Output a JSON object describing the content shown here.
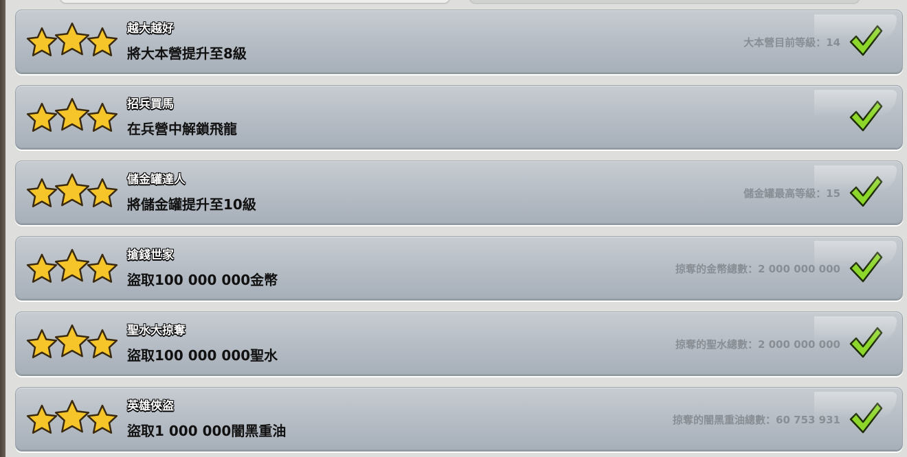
{
  "colors": {
    "card_top": "#c7ccd1",
    "card_bottom": "#a7afb9",
    "star_fill": "#f5c52a",
    "check_fill": "#8dd62a",
    "status_text": "#888e94"
  },
  "icons": {
    "star": "star-icon",
    "check": "checkmark-icon"
  },
  "achievements": [
    {
      "title": "越大越好",
      "description": "將大本營提升至8級",
      "status": "大本營目前等級：14",
      "stars": 3,
      "completed": true
    },
    {
      "title": "招兵買馬",
      "description": "在兵營中解鎖飛龍",
      "status": "",
      "stars": 3,
      "completed": true
    },
    {
      "title": "儲金罐達人",
      "description": "將儲金罐提升至10級",
      "status": "儲金罐最高等級：15",
      "stars": 3,
      "completed": true
    },
    {
      "title": "搶錢世家",
      "description": "盜取100 000 000金幣",
      "status": "掠奪的金幣總數：2 000 000 000",
      "stars": 3,
      "completed": true
    },
    {
      "title": "聖水大掠奪",
      "description": "盜取100 000 000聖水",
      "status": "掠奪的聖水總數：2 000 000 000",
      "stars": 3,
      "completed": true
    },
    {
      "title": "英雄俠盜",
      "description": "盜取1 000 000闇黑重油",
      "status": "掠奪的闇黑重油總數：60 753 931",
      "stars": 3,
      "completed": true
    }
  ]
}
